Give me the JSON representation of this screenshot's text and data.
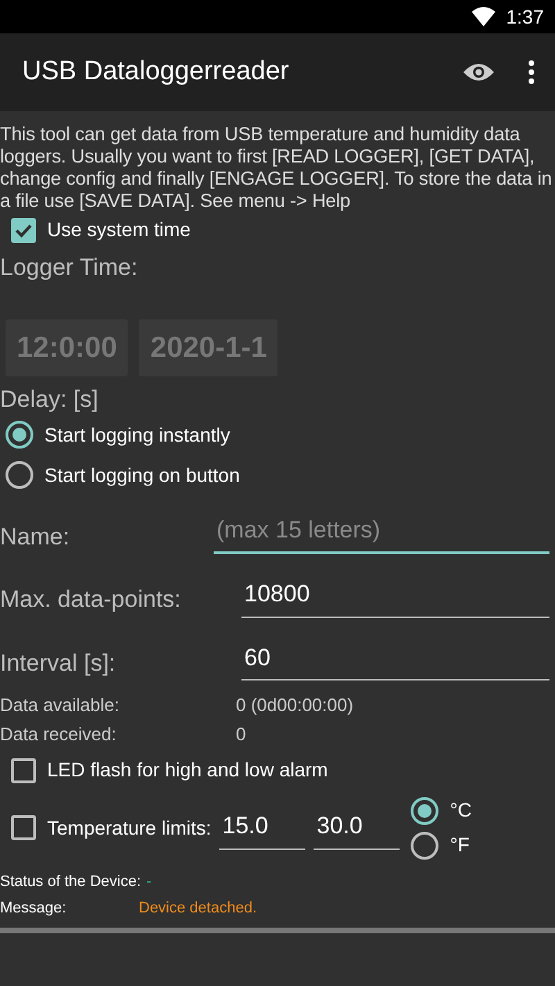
{
  "status_bar": {
    "time": "1:37"
  },
  "app_bar": {
    "title": "USB Dataloggerreader"
  },
  "intro": "This tool can get data from USB temperature and humidity data loggers. Usually you want to first [READ LOGGER], [GET DATA], change config and finally [ENGAGE LOGGER]. To store the data in a file use [SAVE DATA]. See menu -> Help",
  "use_system_time": {
    "label": "Use system time",
    "checked": true
  },
  "logger_time": {
    "label": "Logger Time:",
    "time": "12:0:00",
    "date": "2020-1-1",
    "disabled": true
  },
  "delay": {
    "label": "Delay: [s]",
    "options": [
      {
        "label": "Start logging instantly",
        "selected": true
      },
      {
        "label": "Start logging on button",
        "selected": false
      }
    ]
  },
  "fields": [
    {
      "label": "Name:",
      "placeholder": "(max 15 letters)",
      "focused": true
    },
    {
      "label": "Max. data-points:",
      "value": "10800",
      "focused": false
    },
    {
      "label": "Interval [s]:",
      "value": "60",
      "focused": false
    }
  ],
  "data_info": [
    {
      "label": "Data available:",
      "value": "0 (0d00:00:00)"
    },
    {
      "label": "Data received:",
      "value": "0"
    }
  ],
  "led_flash": {
    "label": "LED flash for high and low alarm",
    "checked": false
  },
  "temperature_limits": {
    "label": "Temperature limits:",
    "checked": false,
    "low": "15.0",
    "high": "30.0",
    "units": [
      {
        "label": "°C",
        "selected": true
      },
      {
        "label": "°F",
        "selected": false
      }
    ]
  },
  "device_status": {
    "label": "Status of the Device:",
    "value": "-"
  },
  "message": {
    "label": "Message:",
    "value": "Device detached."
  }
}
